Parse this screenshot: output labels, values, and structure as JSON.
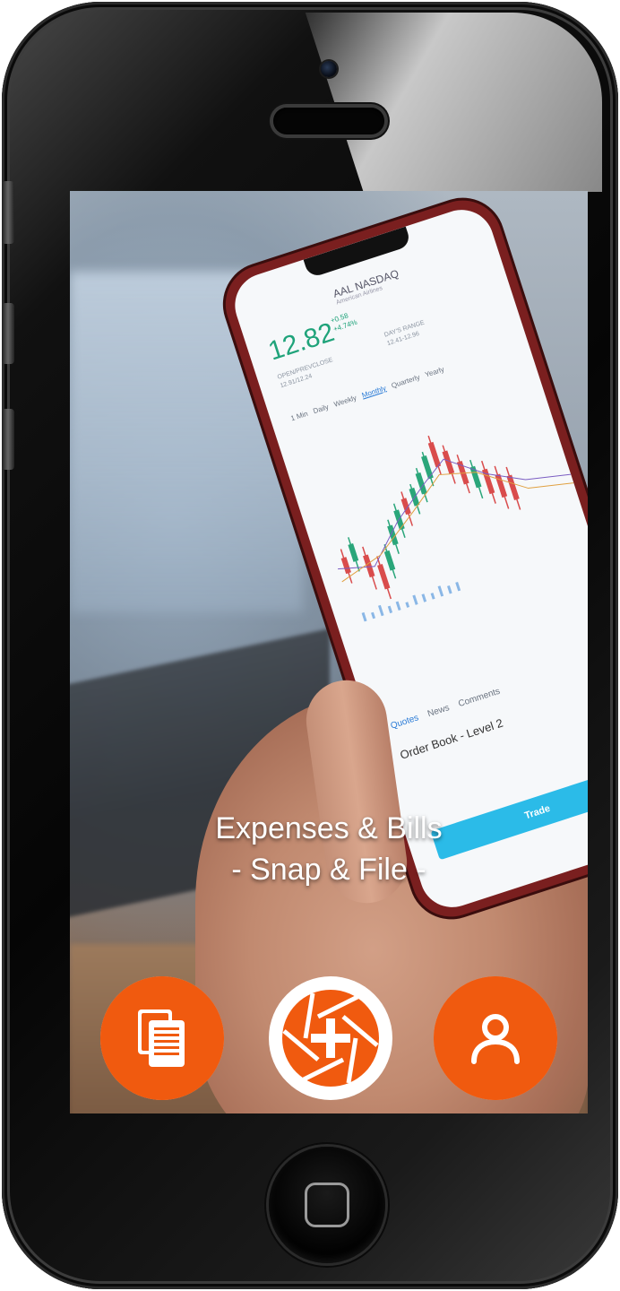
{
  "tagline": {
    "line1": "Expenses & Bills",
    "line2": "- Snap & File -"
  },
  "background_photo": {
    "stock_app": {
      "ticker": "AAL NASDAQ",
      "subtitle": "American Airlines",
      "price": "12.82",
      "change": "+0.58",
      "change_pct": "+4.74%",
      "meta_left_label": "OPEN/PREVCLOSE",
      "meta_left_value": "12.91/12.24",
      "meta_right_label": "DAY'S RANGE",
      "meta_right_value": "12.41-12.96",
      "periods": [
        "1 Min",
        "Daily",
        "Weekly",
        "Monthly",
        "Quarterly",
        "Yearly"
      ],
      "active_period": "Monthly",
      "sections": [
        "Quotes",
        "News",
        "Comments"
      ],
      "active_section": "Quotes",
      "order_book": "Order Book - Level 2",
      "trade_button": "Trade"
    }
  },
  "bottom_nav": {
    "documents_icon": "documents-icon",
    "snap_icon": "camera-shutter-plus-icon",
    "profile_icon": "user-profile-icon",
    "accent_color": "#f05a0f"
  },
  "device": {
    "home_icon": "home-button-icon"
  }
}
